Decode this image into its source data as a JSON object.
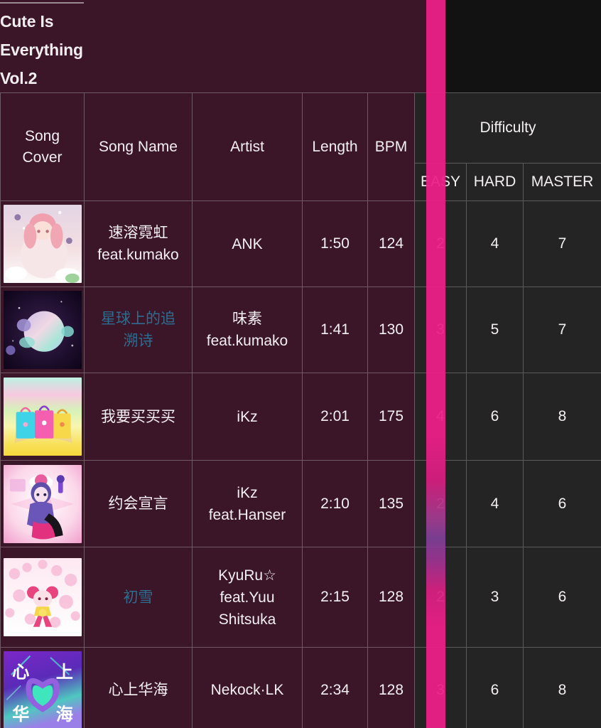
{
  "title": {
    "lines": [
      "Cute Is",
      "Everything",
      "Vol.2"
    ]
  },
  "colors": {
    "table_bg": "#3b1528",
    "difficulty_bg": "#242424",
    "grid": "#6f5a64",
    "accent_pink": "#ec1f86",
    "link": "#2e6d8f",
    "text": "#f4f0f2"
  },
  "table": {
    "headers": {
      "cover": "Song Cover",
      "cover_line1": "Song",
      "cover_line2": "Cover",
      "song_name": "Song Name",
      "artist": "Artist",
      "length": "Length",
      "bpm": "BPM",
      "difficulty": "Difficulty"
    },
    "subheaders": {
      "easy": "EASY",
      "hard": "HARD",
      "master": "MASTER"
    },
    "rows": [
      {
        "cover_alt": "album-cover-pink-girl",
        "song_name": "速溶霓虹\nfeat.kumako",
        "song_name_lines": [
          "速溶霓虹",
          "feat.kumako"
        ],
        "is_link": false,
        "artist_lines": [
          "ANK"
        ],
        "length": "1:50",
        "bpm": "124",
        "easy": "2",
        "hard": "4",
        "master": "7"
      },
      {
        "cover_alt": "album-cover-planet",
        "song_name_lines": [
          "星球上的追",
          "溯诗"
        ],
        "is_link": true,
        "artist_lines": [
          "味素",
          "feat.kumako"
        ],
        "length": "1:41",
        "bpm": "130",
        "easy": "3",
        "hard": "5",
        "master": "7"
      },
      {
        "cover_alt": "album-cover-shopping-bags",
        "song_name_lines": [
          "我要买买买"
        ],
        "is_link": false,
        "artist_lines": [
          "iKz"
        ],
        "length": "2:01",
        "bpm": "175",
        "easy": "4",
        "hard": "6",
        "master": "8"
      },
      {
        "cover_alt": "album-cover-winter-girl",
        "song_name_lines": [
          "约会宣言"
        ],
        "is_link": false,
        "artist_lines": [
          "iKz",
          "feat.Hanser"
        ],
        "length": "2:10",
        "bpm": "135",
        "easy": "2",
        "hard": "4",
        "master": "6"
      },
      {
        "cover_alt": "album-cover-sakura-girl",
        "song_name_lines": [
          "初雪"
        ],
        "is_link": true,
        "artist_lines": [
          "KyuRu☆",
          "feat.Yuu",
          "Shitsuka"
        ],
        "length": "2:15",
        "bpm": "128",
        "easy": "2",
        "hard": "3",
        "master": "6"
      },
      {
        "cover_alt": "album-cover-heart-neon",
        "song_name_lines": [
          "心上华海"
        ],
        "is_link": false,
        "artist_lines": [
          "Nekock·LK"
        ],
        "length": "2:34",
        "bpm": "128",
        "easy": "3",
        "hard": "6",
        "master": "8"
      }
    ]
  }
}
